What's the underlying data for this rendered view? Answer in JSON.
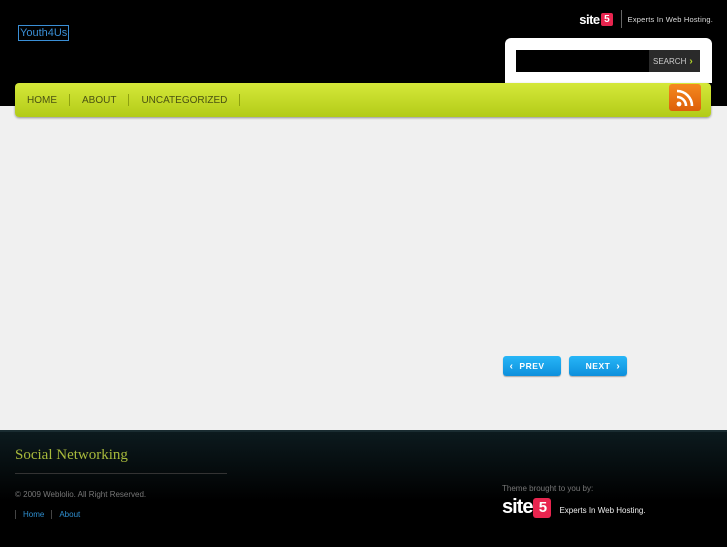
{
  "header": {
    "site_title": "Youth4Us",
    "sponsor": {
      "logo_text": "site",
      "logo_badge": "5",
      "tagline": "Experts In Web Hosting."
    }
  },
  "search": {
    "placeholder": "",
    "button_label": "SEARCH",
    "button_icon": "chevron-right"
  },
  "nav": {
    "items": [
      {
        "label": "HOME"
      },
      {
        "label": "ABOUT"
      },
      {
        "label": "UNCATEGORIZED"
      }
    ],
    "rss_icon": "rss-feed"
  },
  "pagination": {
    "prev_label": "PREV",
    "next_label": "NEXT"
  },
  "footer": {
    "heading": "Social Networking",
    "copyright": "© 2009 Weblolio. All Right Reserved.",
    "links": [
      {
        "label": "Home"
      },
      {
        "label": "About"
      }
    ],
    "credit": {
      "label": "Theme brought to you by:",
      "logo_text": "site",
      "logo_badge": "5",
      "tagline": "Experts In Web Hosting."
    }
  },
  "colors": {
    "header_bg": "#000000",
    "nav_bg": "#c5dc2a",
    "content_bg": "#f0f0f0",
    "accent_blue": "#1aa3ea",
    "rss_orange": "#f07a14",
    "footer_heading": "#a7b93b"
  }
}
